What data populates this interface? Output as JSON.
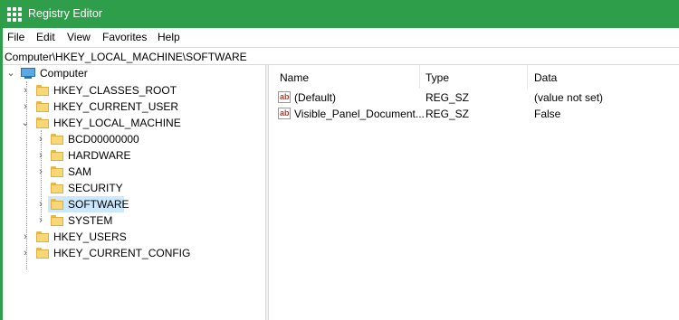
{
  "window": {
    "title": "Registry Editor"
  },
  "menu": [
    "File",
    "Edit",
    "View",
    "Favorites",
    "Help"
  ],
  "address": "Computer\\HKEY_LOCAL_MACHINE\\SOFTWARE",
  "tree": {
    "root": "Computer",
    "hives": [
      "HKEY_CLASSES_ROOT",
      "HKEY_CURRENT_USER",
      "HKEY_LOCAL_MACHINE",
      "HKEY_USERS",
      "HKEY_CURRENT_CONFIG"
    ],
    "hklm_children": [
      "BCD00000000",
      "HARDWARE",
      "SAM",
      "SECURITY",
      "SOFTWARE",
      "SYSTEM"
    ],
    "selected": "SOFTWARE"
  },
  "columns": {
    "name": "Name",
    "type": "Type",
    "data": "Data"
  },
  "values": [
    {
      "name": "(Default)",
      "type": "REG_SZ",
      "data": "(value not set)",
      "icon": "string-value-icon"
    },
    {
      "name": "Visible_Panel_Document...",
      "type": "REG_SZ",
      "data": "False",
      "icon": "string-value-icon"
    }
  ],
  "colors": {
    "titlebar": "#2e9e4b",
    "selection": "#cce8ff",
    "folder": "#f8d775"
  }
}
